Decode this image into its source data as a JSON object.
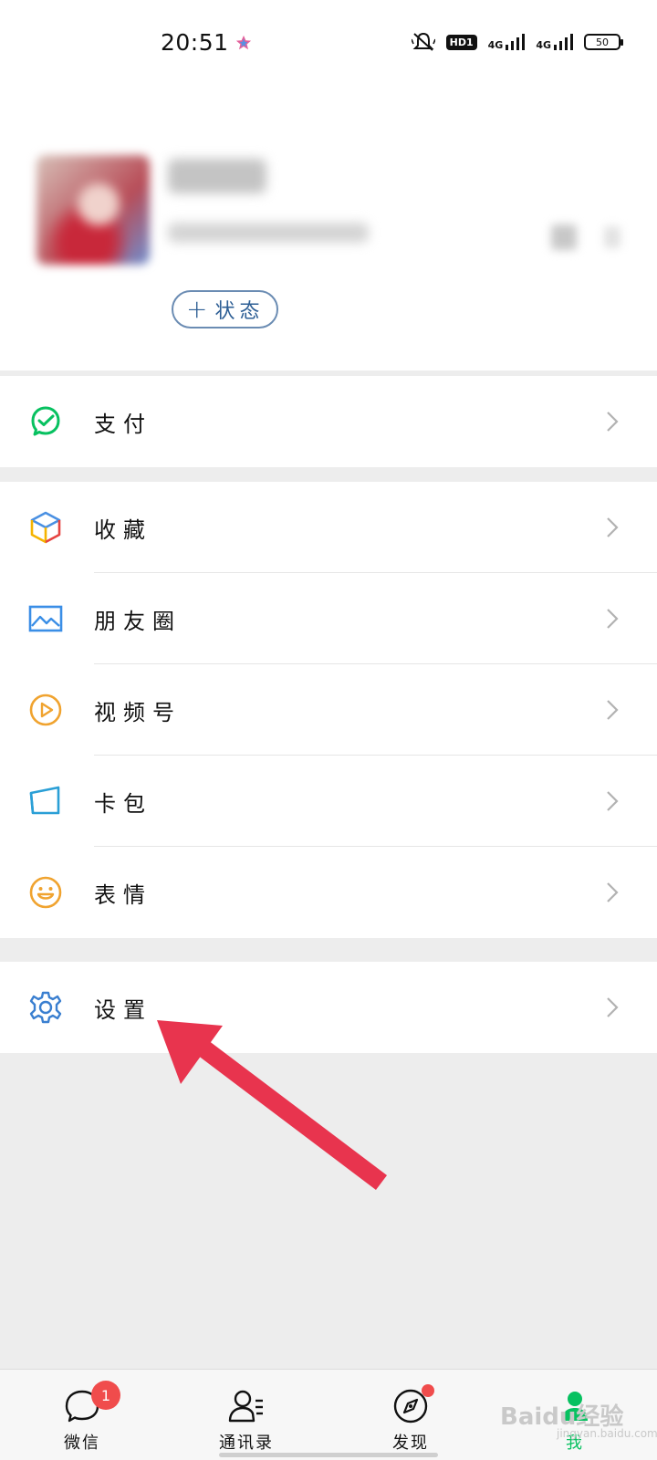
{
  "status_bar": {
    "time": "20:51",
    "hd": "HD1",
    "net1": "4G",
    "net2": "4G",
    "battery": "50"
  },
  "profile": {
    "status_button_label": "状态",
    "status_plus": "+"
  },
  "menu": {
    "pay": "支付",
    "favorites": "收藏",
    "moments": "朋友圈",
    "channels": "视频号",
    "cards": "卡包",
    "stickers": "表情",
    "settings": "设置"
  },
  "tabbar": {
    "chats": "微信",
    "chats_badge": "1",
    "contacts": "通讯录",
    "discover": "发现",
    "me": "我"
  },
  "watermark": {
    "text": "Baidu经验",
    "sub": "jingyan.baidu.com"
  },
  "colors": {
    "accent": "#07c160",
    "annotation_arrow": "#e8344e",
    "badge": "#f04c4c"
  }
}
